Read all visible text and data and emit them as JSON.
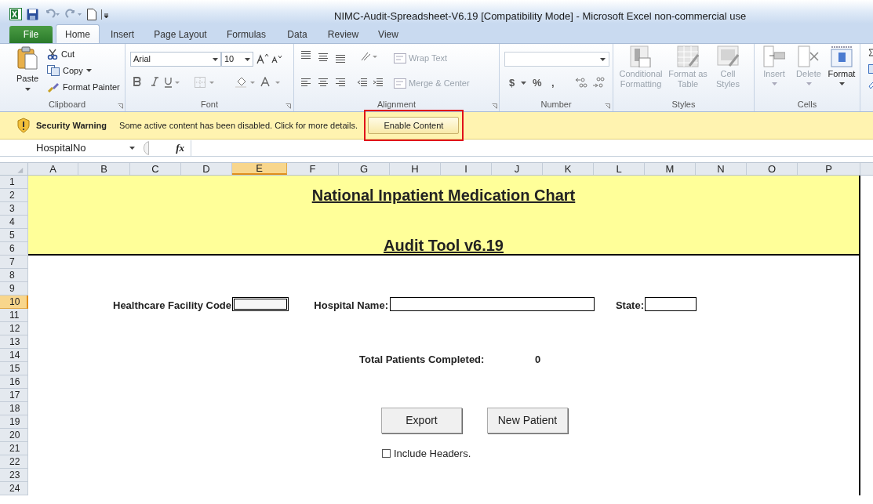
{
  "window": {
    "title": "NIMC-Audit-Spreadsheet-V6.19  [Compatibility Mode]  -  Microsoft Excel non-commercial use"
  },
  "ribbon_tabs": [
    {
      "label": "File",
      "kind": "file",
      "selected": false
    },
    {
      "label": "Home",
      "kind": "tab",
      "selected": true
    },
    {
      "label": "Insert",
      "kind": "tab",
      "selected": false
    },
    {
      "label": "Page Layout",
      "kind": "tab",
      "selected": false
    },
    {
      "label": "Formulas",
      "kind": "tab",
      "selected": false
    },
    {
      "label": "Data",
      "kind": "tab",
      "selected": false
    },
    {
      "label": "Review",
      "kind": "tab",
      "selected": false
    },
    {
      "label": "View",
      "kind": "tab",
      "selected": false
    }
  ],
  "ribbon": {
    "clipboard": {
      "label": "Clipboard",
      "paste": "Paste",
      "cut": "Cut",
      "copy": "Copy",
      "format_painter": "Format Painter"
    },
    "font": {
      "label": "Font",
      "font_name": "Arial",
      "font_size": "10"
    },
    "alignment": {
      "label": "Alignment",
      "wrap_text": {
        "label": "Wrap Text",
        "disabled": true
      },
      "merge_center": {
        "label": "Merge & Center",
        "disabled": true
      }
    },
    "number": {
      "label": "Number",
      "symbols": [
        "$",
        "%",
        ","
      ]
    },
    "styles": {
      "label": "Styles",
      "items": [
        {
          "label": "Conditional Formatting",
          "disabled": true
        },
        {
          "label": "Format as Table",
          "disabled": true
        },
        {
          "label": "Cell Styles",
          "disabled": true
        }
      ]
    },
    "cells": {
      "label": "Cells",
      "items": [
        {
          "label": "Insert",
          "disabled": true
        },
        {
          "label": "Delete",
          "disabled": true
        },
        {
          "label": "Format",
          "disabled": false
        }
      ]
    }
  },
  "security_bar": {
    "title": "Security Warning",
    "message": "Some active content has been disabled. Click for more details.",
    "button": "Enable Content"
  },
  "formula_bar": {
    "name_box": "HospitalNo",
    "function_label": "fx"
  },
  "columns": [
    {
      "label": "A",
      "selected": false
    },
    {
      "label": "B",
      "selected": false
    },
    {
      "label": "C",
      "selected": false
    },
    {
      "label": "D",
      "selected": false
    },
    {
      "label": "E",
      "selected": true
    },
    {
      "label": "F",
      "selected": false
    },
    {
      "label": "G",
      "selected": false
    },
    {
      "label": "H",
      "selected": false
    },
    {
      "label": "I",
      "selected": false
    },
    {
      "label": "J",
      "selected": false
    },
    {
      "label": "K",
      "selected": false
    },
    {
      "label": "L",
      "selected": false
    },
    {
      "label": "M",
      "selected": false
    },
    {
      "label": "N",
      "selected": false
    },
    {
      "label": "O",
      "selected": false
    },
    {
      "label": "P",
      "selected": false
    }
  ],
  "rows": [
    {
      "label": "1",
      "selected": false
    },
    {
      "label": "2",
      "selected": false
    },
    {
      "label": "3",
      "selected": false
    },
    {
      "label": "4",
      "selected": false
    },
    {
      "label": "5",
      "selected": false
    },
    {
      "label": "6",
      "selected": false
    },
    {
      "label": "7",
      "selected": false
    },
    {
      "label": "8",
      "selected": false
    },
    {
      "label": "9",
      "selected": false
    },
    {
      "label": "10",
      "selected": true
    },
    {
      "label": "11",
      "selected": false
    },
    {
      "label": "12",
      "selected": false
    },
    {
      "label": "13",
      "selected": false
    },
    {
      "label": "14",
      "selected": false
    },
    {
      "label": "15",
      "selected": false
    },
    {
      "label": "16",
      "selected": false
    },
    {
      "label": "17",
      "selected": false
    },
    {
      "label": "18",
      "selected": false
    },
    {
      "label": "19",
      "selected": false
    },
    {
      "label": "20",
      "selected": false
    },
    {
      "label": "21",
      "selected": false
    },
    {
      "label": "22",
      "selected": false
    },
    {
      "label": "23",
      "selected": false
    },
    {
      "label": "24",
      "selected": false
    }
  ],
  "sheet": {
    "title": "National Inpatient Medication Chart",
    "subtitle": "Audit Tool v6.19",
    "fields": [
      {
        "label": "Healthcare Facility Code",
        "selected": true
      },
      {
        "label": "Hospital Name:",
        "selected": false
      },
      {
        "label": "State:",
        "selected": false
      }
    ],
    "total_label": "Total Patients Completed:",
    "total_value": "0",
    "buttons": [
      "Export",
      "New Patient"
    ],
    "include_headers": {
      "label": "Include Headers.",
      "checked": false
    }
  }
}
